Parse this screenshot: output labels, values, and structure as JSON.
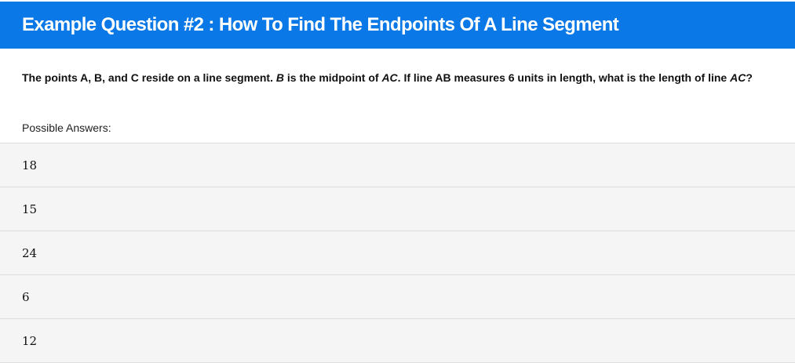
{
  "header": {
    "title": "Example Question #2 : How To Find The Endpoints Of A Line Segment"
  },
  "question": {
    "part1": "The points A, B, and C reside on a line segment. ",
    "var_b": "B",
    "part2": " is the midpoint of ",
    "var_ac1": "AC",
    "part3": ". If line AB measures 6 units in length, what is the length of line ",
    "var_ac2": "AC",
    "part4": "?"
  },
  "possible_answers_label": "Possible Answers:",
  "answers": [
    {
      "text": "18"
    },
    {
      "text": "15"
    },
    {
      "text": "24"
    },
    {
      "text": "6"
    },
    {
      "text": "12"
    }
  ],
  "colors": {
    "header_bg": "#0a78e6",
    "answer_bg": "#f5f5f5",
    "divider": "#dddddd"
  }
}
